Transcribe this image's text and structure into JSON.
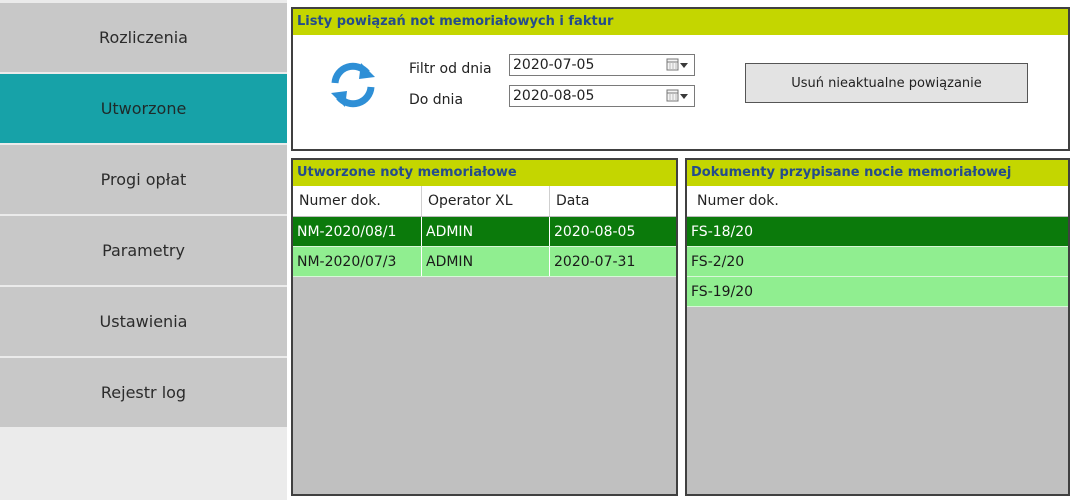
{
  "sidebar": {
    "items": [
      {
        "label": "Rozliczenia",
        "active": false
      },
      {
        "label": "Utworzone",
        "active": true
      },
      {
        "label": "Progi opłat",
        "active": false
      },
      {
        "label": "Parametry",
        "active": false
      },
      {
        "label": "Ustawienia",
        "active": false
      },
      {
        "label": "Rejestr log",
        "active": false
      }
    ]
  },
  "top_panel": {
    "title": "Listy powiązań not memoriałowych i faktur",
    "refresh_icon": "refresh-icon",
    "filter_from_label": "Filtr od dnia",
    "filter_from_value": "2020-07-05",
    "filter_to_label": "Do dnia",
    "filter_to_value": "2020-08-05",
    "remove_button_label": "Usuń nieaktualne powiązanie"
  },
  "notes_panel": {
    "title": "Utworzone noty memoriałowe",
    "columns": [
      "Numer dok.",
      "Operator XL",
      "Data"
    ],
    "rows": [
      {
        "cells": [
          "NM-2020/08/1",
          "ADMIN",
          "2020-08-05"
        ],
        "selected": true
      },
      {
        "cells": [
          "NM-2020/07/3",
          "ADMIN",
          "2020-07-31"
        ],
        "selected": false
      }
    ]
  },
  "docs_panel": {
    "title": "Dokumenty przypisane nocie memoriałowej",
    "columns": [
      "Numer dok."
    ],
    "rows": [
      {
        "cells": [
          "FS-18/20"
        ],
        "selected": true
      },
      {
        "cells": [
          "FS-2/20"
        ],
        "selected": false
      },
      {
        "cells": [
          "FS-19/20"
        ],
        "selected": false
      }
    ]
  },
  "colors": {
    "header_bg": "#c4d600",
    "header_text": "#244c8c",
    "sidebar_active": "#17a2a8",
    "row_selected": "#0b7a0b",
    "row_normal": "#90ee90"
  }
}
